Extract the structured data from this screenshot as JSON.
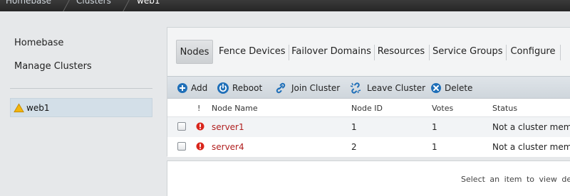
{
  "breadcrumb": {
    "items": [
      "Homebase",
      "Clusters",
      "web1"
    ]
  },
  "sidebar": {
    "links": [
      "Homebase",
      "Manage Clusters"
    ],
    "cluster": {
      "name": "web1",
      "status_icon": "warning-icon",
      "status_color": "#f0b400"
    }
  },
  "tabs": [
    "Nodes",
    "Fence Devices",
    "Failover Domains",
    "Resources",
    "Service Groups",
    "Configure"
  ],
  "active_tab": "Nodes",
  "toolbar": {
    "add": "Add",
    "reboot": "Reboot",
    "join": "Join Cluster",
    "leave": "Leave Cluster",
    "delete": "Delete"
  },
  "table": {
    "columns": [
      "!",
      "Node Name",
      "Node ID",
      "Votes",
      "Status"
    ],
    "rows": [
      {
        "name": "server1",
        "node_id": "1",
        "votes": "1",
        "status": "Not a cluster membe"
      },
      {
        "name": "server4",
        "node_id": "2",
        "votes": "1",
        "status": "Not a cluster membe"
      }
    ]
  },
  "details_hint": "Select an item to view details",
  "colors": {
    "error_red": "#d9261c",
    "node_name_red": "#b01e1e",
    "toolbar_icon_blue": "#1f6fb8"
  }
}
